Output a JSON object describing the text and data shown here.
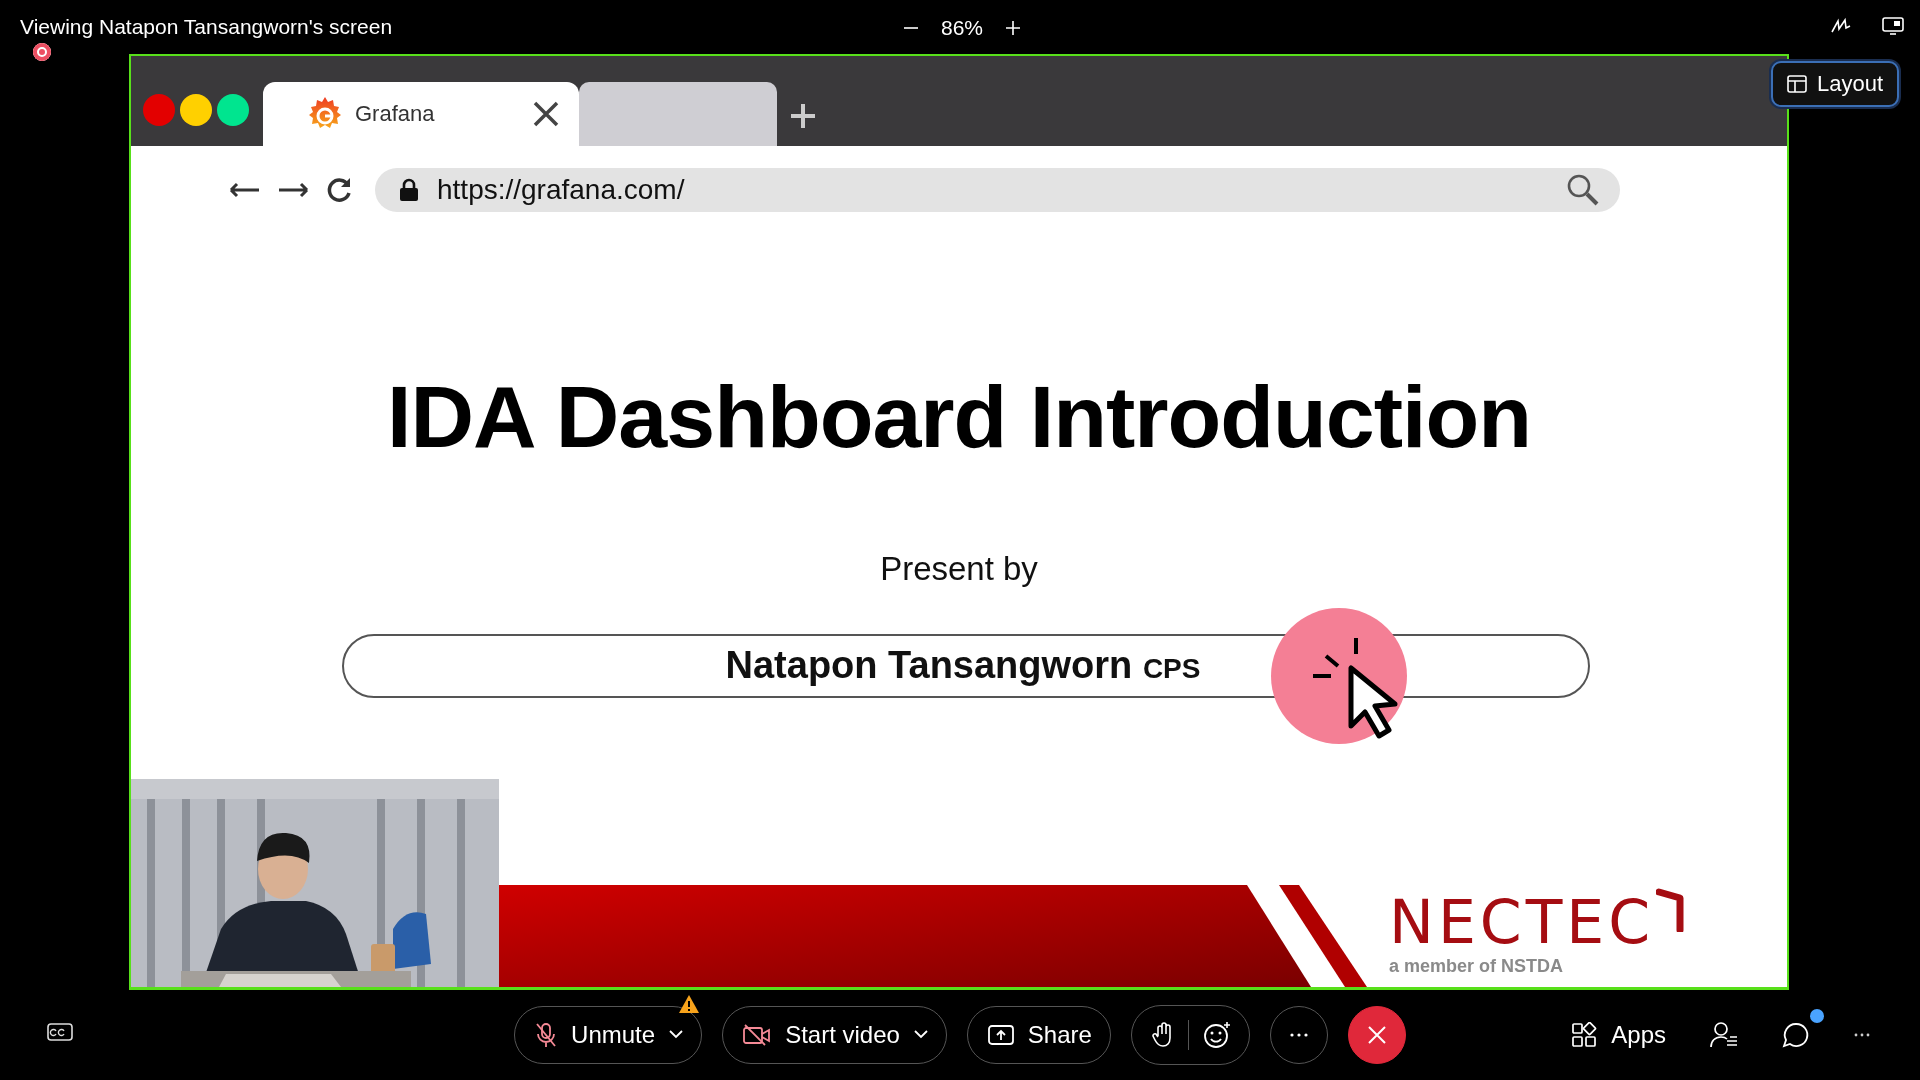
{
  "header": {
    "title": "Viewing Natapon Tansangworn's screen",
    "recording": true,
    "zoom": "86%"
  },
  "layout_button": {
    "label": "Layout"
  },
  "browser": {
    "tabs": [
      {
        "kind": "page",
        "label": "Grafana",
        "selected": true
      },
      {
        "kind": "blank",
        "selected": false
      }
    ],
    "url": "https://grafana.com/"
  },
  "slide": {
    "title": "IDA Dashboard Introduction",
    "subtitle": "Present by",
    "presenter": {
      "name": "Natapon Tansangworn",
      "tag": "CPS"
    },
    "logo": {
      "name": "NECTEC",
      "tagline": "a member of NSTDA"
    }
  },
  "toolbar": {
    "mic": {
      "label": "Unmute",
      "muted": true,
      "warning": true
    },
    "camera": {
      "label": "Start video",
      "on": false
    },
    "share": {
      "label": "Share"
    },
    "apps": {
      "label": "Apps"
    },
    "chat": {
      "unread": true
    }
  }
}
